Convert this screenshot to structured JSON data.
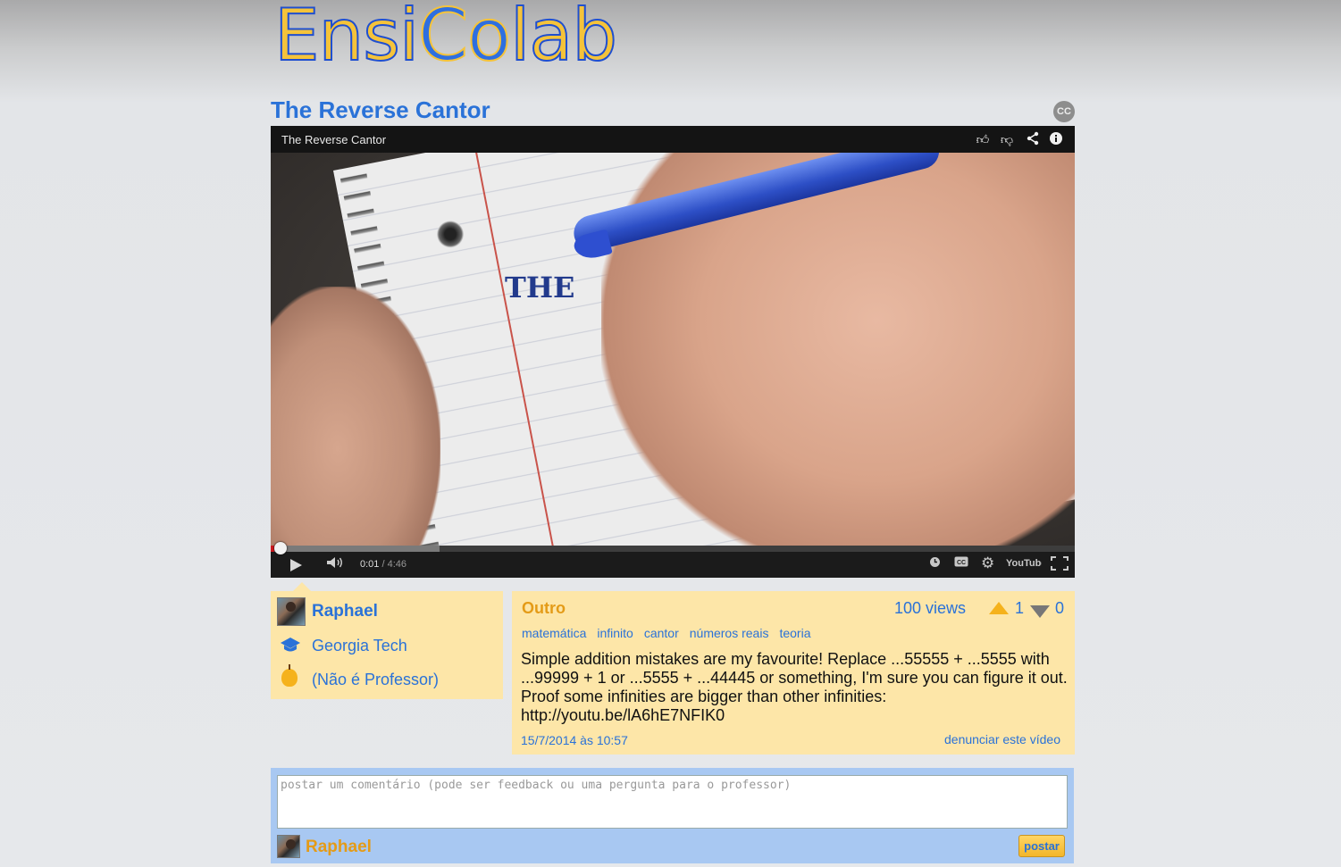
{
  "brand": {
    "logo_part1": "Ensi",
    "logo_part2": "Co",
    "logo_part3": "lab"
  },
  "video": {
    "title": "The Reverse Cantor",
    "player_title": "The Reverse Cantor",
    "handwriting": "THE",
    "current_time": "0:01",
    "duration": "/ 4:46",
    "progress_fraction": 0.004,
    "buffered_fraction": 0.21,
    "cc_badge": "CC",
    "icons": [
      "like-icon",
      "dislike-icon",
      "share-icon",
      "info-icon",
      "play-icon",
      "volume-icon",
      "watch-later-icon",
      "captions-icon",
      "settings-icon",
      "youtube-logo",
      "fullscreen-icon"
    ],
    "youtube_label": "YouTube"
  },
  "author": {
    "name": "Raphael",
    "school": "Georgia Tech",
    "role": "(Não é Professor)"
  },
  "details": {
    "category": "Outro",
    "views": "100 views",
    "upvotes": "1",
    "downvotes": "0",
    "tags": [
      "matemática",
      "infinito",
      "cantor",
      "números reais",
      "teoria"
    ],
    "description": "Simple addition mistakes are my favourite! Replace ...55555 + ...5555 with ...99999 + 1 or ...5555 + ...44445 or something, I'm sure you can figure it out. Proof some infinities are bigger than other infinities: http://youtu.be/lA6hE7NFIK0",
    "date": "15/7/2014 às 10:57",
    "report_link": "denunciar este vídeo"
  },
  "comment": {
    "placeholder": "postar um comentário (pode ser feedback ou uma pergunta para o professor)",
    "value": "",
    "user": "Raphael",
    "post_label": "postar"
  },
  "colors": {
    "accent_blue": "#2a72d8",
    "accent_orange": "#e49b17",
    "panel_yellow": "#fde6a8",
    "panel_blue": "#a8c8f2"
  }
}
